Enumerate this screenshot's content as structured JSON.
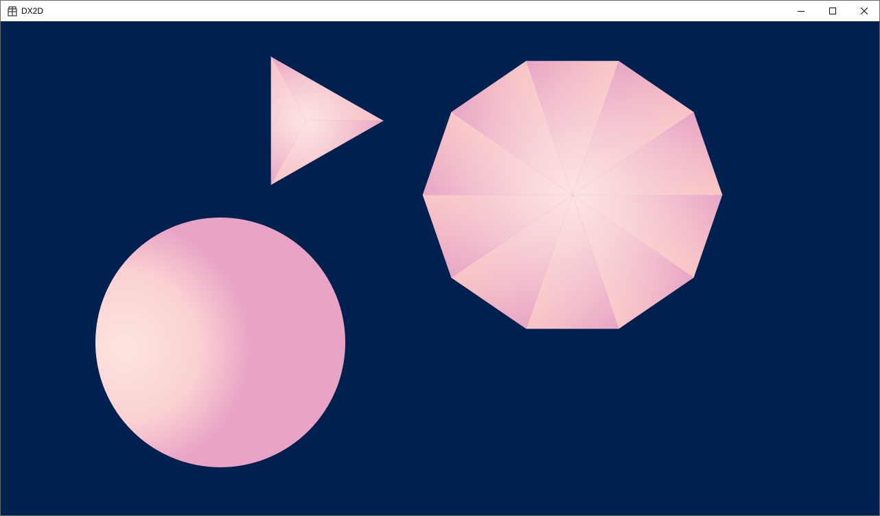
{
  "window": {
    "title": "DX2D",
    "controls": {
      "minimize": "minimize-icon",
      "maximize": "maximize-icon",
      "close": "close-icon"
    }
  },
  "scene": {
    "background": "#002050",
    "gradient": {
      "light": "#fde5e2",
      "mid": "#f9c7c5",
      "deep": "#e8a3c5"
    },
    "shapes": [
      {
        "kind": "triangle",
        "sides": 3
      },
      {
        "kind": "decagon",
        "sides": 10
      },
      {
        "kind": "circle"
      }
    ]
  }
}
